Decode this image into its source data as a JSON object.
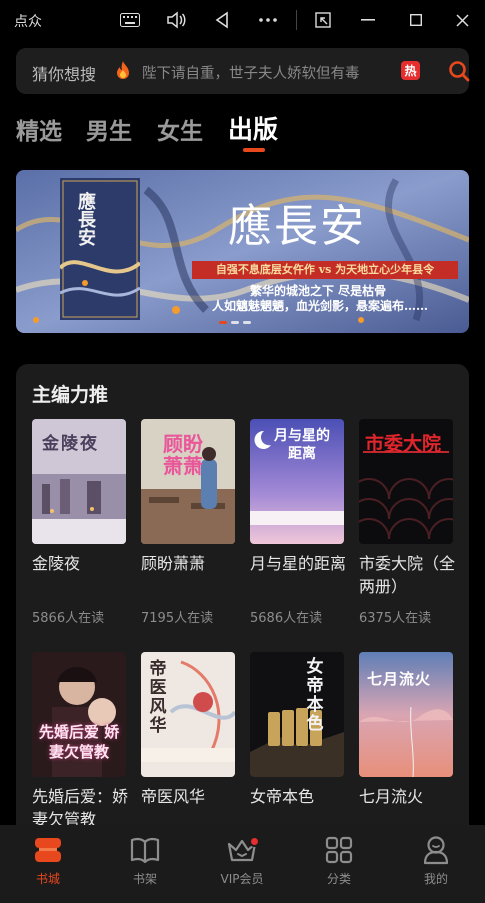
{
  "window": {
    "title": "点众"
  },
  "search": {
    "prefix": "猜你想搜",
    "query": "陛下请自重，世子夫人娇软但有毒",
    "hot_label": "热"
  },
  "tabs": [
    {
      "label": "精选",
      "active": false
    },
    {
      "label": "男生",
      "active": false
    },
    {
      "label": "女生",
      "active": false
    },
    {
      "label": "出版",
      "active": true
    }
  ],
  "banner": {
    "cover_title": "應長安",
    "title": "應長安",
    "tagline": "自强不息底层女仵作 vs 为天地立心少年县令",
    "line1": "繁华的城池之下 尽是枯骨",
    "line2": "人如魑魅魍魉，血光剑影，悬案遍布……",
    "slides": 3,
    "active_slide": 0
  },
  "picks": {
    "title": "主编力推",
    "books": [
      {
        "name": "金陵夜",
        "readers": "5866人在读",
        "cover_text": "金陵夜"
      },
      {
        "name": "顾盼萧萧",
        "readers": "7195人在读",
        "cover_text": "顾盼萧萧"
      },
      {
        "name": "月与星的距离",
        "readers": "5686人在读",
        "cover_text": "月与星的距离"
      },
      {
        "name": "市委大院（全两册）",
        "readers": "6375人在读",
        "cover_text": "市委大院"
      },
      {
        "name": "先婚后爱：娇妻欠管教",
        "readers": "",
        "cover_text": "先婚后爱 娇妻欠管教"
      },
      {
        "name": "帝医风华",
        "readers": "",
        "cover_text": "帝医风华"
      },
      {
        "name": "女帝本色",
        "readers": "",
        "cover_text": "女帝本色"
      },
      {
        "name": "七月流火",
        "readers": "",
        "cover_text": "七月流火"
      }
    ]
  },
  "nav": [
    {
      "label": "书城",
      "icon": "bookstore-icon",
      "active": true
    },
    {
      "label": "书架",
      "icon": "bookshelf-icon",
      "active": false
    },
    {
      "label": "VIP会员",
      "icon": "vip-crown-icon",
      "active": false
    },
    {
      "label": "分类",
      "icon": "category-grid-icon",
      "active": false
    },
    {
      "label": "我的",
      "icon": "profile-icon",
      "active": false
    }
  ],
  "colors": {
    "accent": "#e8481d",
    "hot": "#e62e2e",
    "background": "#000000",
    "card": "#1c1c1c"
  }
}
